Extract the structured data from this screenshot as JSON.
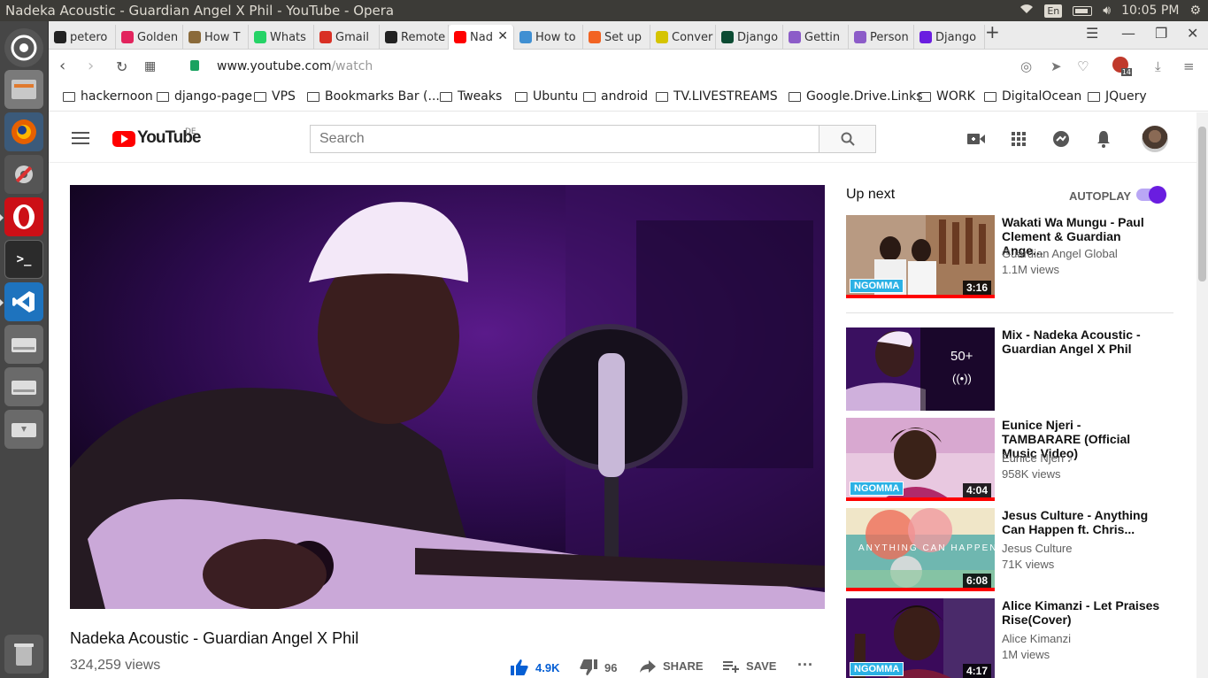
{
  "os": {
    "window_title": "Nadeka Acoustic - Guardian Angel X Phil - YouTube - Opera",
    "keyboard_layout": "En",
    "clock": "10:05 PM"
  },
  "launcher": {
    "apps": [
      "ubuntu-dash",
      "files",
      "firefox",
      "system-settings",
      "opera",
      "terminal",
      "vscode",
      "drive-1",
      "drive-2",
      "drive-3",
      "trash"
    ]
  },
  "tabs": [
    {
      "label": "petero",
      "icon": "github-icon",
      "color": "#222222"
    },
    {
      "label": "Golden",
      "icon": "golden-icon",
      "color": "#e2245d"
    },
    {
      "label": "How T",
      "icon": "howto-icon",
      "color": "#8a6a3a"
    },
    {
      "label": "Whats",
      "icon": "whatsapp-icon",
      "color": "#25d366"
    },
    {
      "label": "Gmail",
      "icon": "gmail-icon",
      "color": "#d93025"
    },
    {
      "label": "Remote",
      "icon": "remote-icon",
      "color": "#222222"
    },
    {
      "label": "Nad",
      "icon": "youtube-icon",
      "color": "#ff0000",
      "active": true
    },
    {
      "label": "How to",
      "icon": "stack-icon",
      "color": "#3f8fd2"
    },
    {
      "label": "Set up",
      "icon": "magento-icon",
      "color": "#f26322"
    },
    {
      "label": "Conver",
      "icon": "smile-icon",
      "color": "#d5c400"
    },
    {
      "label": "Django",
      "icon": "django-icon",
      "color": "#0c4b33"
    },
    {
      "label": "Gettin",
      "icon": "h-icon",
      "color": "#8c5cc8"
    },
    {
      "label": "Person",
      "icon": "h-icon",
      "color": "#8c5cc8"
    },
    {
      "label": "Django",
      "icon": "d-icon",
      "color": "#6a1de0"
    }
  ],
  "addressbar": {
    "url_domain": "www.youtube.com",
    "url_path": "/watch",
    "badge_count": "14"
  },
  "bookmarks": [
    "hackernoon",
    "django-page",
    "VPS",
    "Bookmarks Bar (...",
    "Tweaks",
    "Ubuntu",
    "android",
    "TV.LIVESTREAMS",
    "Google.Drive.Links",
    "WORK",
    "DigitalOcean",
    "JQuery"
  ],
  "youtube": {
    "logo_text": "YouTube",
    "region": "DE",
    "search_placeholder": "Search",
    "video": {
      "title": "Nadeka Acoustic - Guardian Angel X Phil",
      "views": "324,259 views",
      "likes": "4.9K",
      "dislikes": "96",
      "share_label": "SHARE",
      "save_label": "SAVE"
    },
    "up_next_label": "Up next",
    "autoplay_label": "AUTOPLAY",
    "autoplay_on": true,
    "recommendations": [
      {
        "title": "Wakati Wa Mungu - Paul Clement & Guardian Ange...",
        "channel": "Guardian Angel Global",
        "views": "1.1M views",
        "duration": "3:16",
        "badge": "NGOMMA"
      },
      {
        "title": "Mix - Nadeka Acoustic - Guardian Angel X Phil",
        "channel": "",
        "views": "",
        "duration": "",
        "playlist_count": "50+"
      },
      {
        "title": "Eunice Njeri - TAMBARARE (Official Music Video)",
        "channel": "Eunice Njeri",
        "views": "958K views",
        "duration": "4:04",
        "badge": "NGOMMA"
      },
      {
        "title": "Jesus Culture - Anything Can Happen ft. Chris...",
        "channel": "Jesus Culture",
        "views": "71K views",
        "duration": "6:08",
        "overlay_text": "ANYTHING CAN HAPPEN"
      },
      {
        "title": "Alice Kimanzi - Let Praises Rise(Cover)",
        "channel": "Alice Kimanzi",
        "views": "1M views",
        "duration": "4:17",
        "badge": "NGOMMA"
      }
    ]
  }
}
